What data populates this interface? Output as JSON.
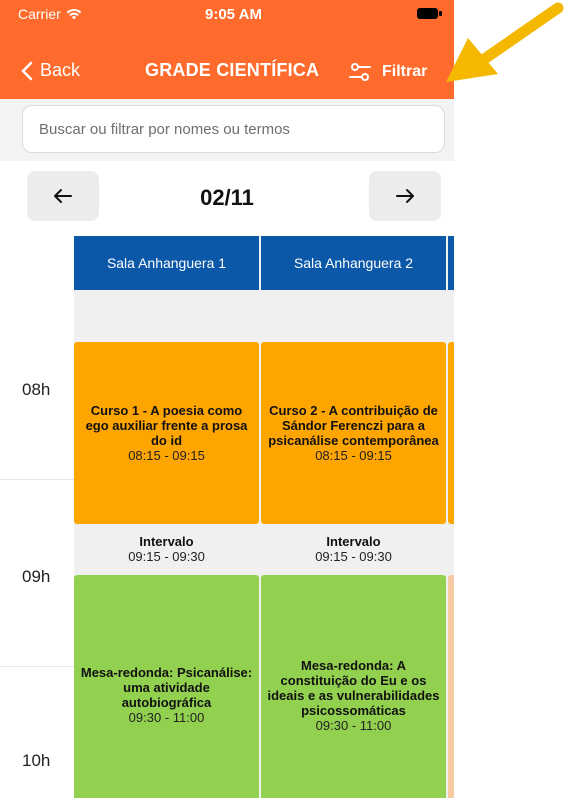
{
  "status": {
    "carrier": "Carrier",
    "time": "9:05 AM"
  },
  "nav": {
    "back_label": "Back",
    "title": "GRADE CIENTÍFICA",
    "filter_label": "Filtrar"
  },
  "search": {
    "placeholder": "Buscar ou filtrar por nomes ou termos"
  },
  "date": {
    "current": "02/11"
  },
  "hours": [
    "08h",
    "09h",
    "10h"
  ],
  "rooms": [
    "Sala Anhanguera 1",
    "Sala Anhanguera 2"
  ],
  "sessions": {
    "course1": {
      "title": "Curso 1 - A poesia como ego auxiliar frente a prosa do id",
      "time": "08:15 - 09:15"
    },
    "course2": {
      "title": "Curso 2 - A contribuição de Sándor Ferenczi para a psicanálise contemporânea",
      "time": "08:15 - 09:15"
    },
    "interval1": {
      "title": "Intervalo",
      "time": "09:15 - 09:30"
    },
    "interval2": {
      "title": "Intervalo",
      "time": "09:15 - 09:30"
    },
    "round1": {
      "title": "Mesa-redonda: Psicanálise: uma atividade autobiográfica",
      "time": "09:30 - 11:00"
    },
    "round2": {
      "title": "Mesa-redonda: A constituição do Eu e os ideais e as vulnerabilidades psicossomáticas",
      "time": "09:30 - 11:00"
    }
  },
  "colors": {
    "nav_bg": "#FF6B2C",
    "room_header": "#0B57A8",
    "course": "#FFA500",
    "round_table": "#92D050",
    "annotation_arrow": "#F5B800"
  }
}
